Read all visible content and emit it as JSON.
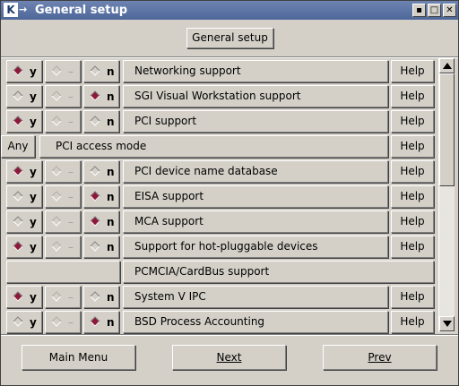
{
  "window": {
    "title": "General setup",
    "icon": "kde-k-icon",
    "icon_letter": "K",
    "arrow_glyph": "→",
    "buttons": {
      "minimize": "▪",
      "maximize": "□",
      "close": "✕"
    }
  },
  "header": {
    "button_label": "General setup"
  },
  "option_labels": {
    "y": "y",
    "m": "–",
    "n": "n"
  },
  "colors": {
    "selected_diamond": "#8b1a3a",
    "titlebar": "#4d6799"
  },
  "rows": [
    {
      "type": "bool",
      "selected": "y",
      "label": "Networking support",
      "help": "Help"
    },
    {
      "type": "bool",
      "selected": "n",
      "label": "SGI Visual Workstation support",
      "help": "Help"
    },
    {
      "type": "bool",
      "selected": "y",
      "label": "PCI support",
      "help": "Help"
    },
    {
      "type": "choice",
      "value": "Any",
      "label": "PCI access mode",
      "help": "Help"
    },
    {
      "type": "bool",
      "selected": "y",
      "label": "PCI device name database",
      "help": "Help"
    },
    {
      "type": "bool",
      "selected": "n",
      "label": "EISA support",
      "help": "Help"
    },
    {
      "type": "bool",
      "selected": "n",
      "label": "MCA support",
      "help": "Help"
    },
    {
      "type": "bool",
      "selected": "y",
      "label": "Support for hot-pluggable devices",
      "help": "Help"
    },
    {
      "type": "submenu",
      "label": "PCMCIA/CardBus support"
    },
    {
      "type": "bool",
      "selected": "y",
      "label": "System V IPC",
      "help": "Help"
    },
    {
      "type": "bool",
      "selected": "n",
      "label": "BSD Process Accounting",
      "help": "Help"
    }
  ],
  "footer": {
    "main_menu": "Main Menu",
    "next": "Next",
    "prev": "Prev"
  }
}
